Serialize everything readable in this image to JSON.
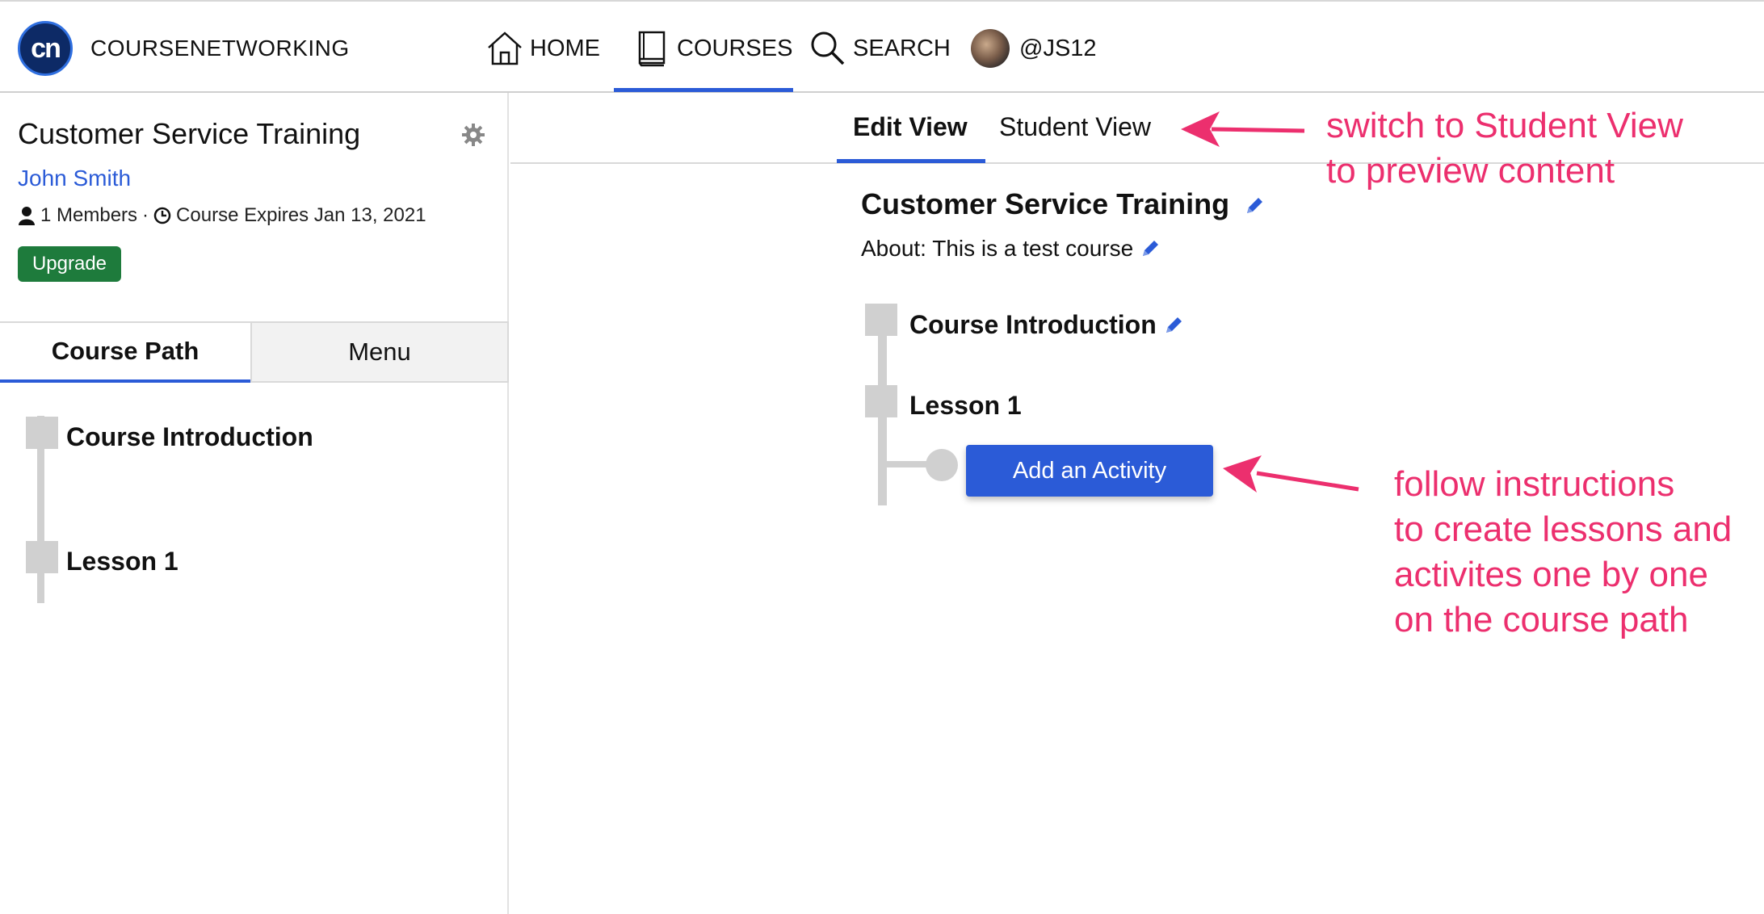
{
  "nav": {
    "brand": "COURSENETWORKING",
    "logo_text": "cn",
    "home": "HOME",
    "courses": "COURSES",
    "search": "SEARCH",
    "profile": "@JS12"
  },
  "left": {
    "course_title": "Customer Service Training",
    "owner": "John Smith",
    "members": "1 Members",
    "separator": "·",
    "expires": "Course Expires Jan 13, 2021",
    "upgrade": "Upgrade",
    "tabs": {
      "path": "Course Path",
      "menu": "Menu"
    },
    "path_items": [
      "Course Introduction",
      "Lesson 1"
    ]
  },
  "right": {
    "view_tabs": {
      "edit": "Edit View",
      "student": "Student View"
    },
    "title": "Customer Service Training",
    "about": "About: This is a test course",
    "items": [
      "Course Introduction",
      "Lesson 1"
    ],
    "add_activity": "Add an Activity"
  },
  "annotations": {
    "top": "switch to Student View\nto preview content",
    "bottom": "follow instructions\nto create lessons and\nactivites one by one\non the course path"
  },
  "colors": {
    "accent": "#2b5bd7",
    "annotation": "#ec2f6e",
    "upgrade": "#1e7b3c"
  }
}
